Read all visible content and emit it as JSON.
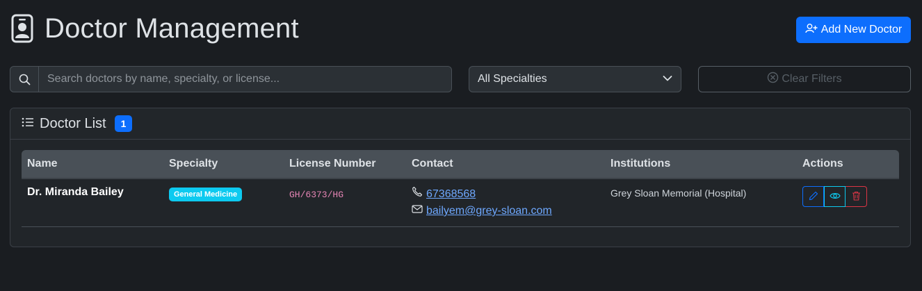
{
  "header": {
    "title": "Doctor Management",
    "add_button_label": "Add New Doctor"
  },
  "filters": {
    "search_placeholder": "Search doctors by name, specialty, or license...",
    "specialty_selected": "All Specialties",
    "clear_label": "Clear Filters"
  },
  "list": {
    "title": "Doctor List",
    "count": "1",
    "columns": [
      "Name",
      "Specialty",
      "License Number",
      "Contact",
      "Institutions",
      "Actions"
    ],
    "rows": [
      {
        "name": "Dr. Miranda Bailey",
        "specialty": "General Medicine",
        "license": "GH/6373/HG",
        "phone": "67368568",
        "email": "bailyem@grey-sloan.com",
        "institution": "Grey Sloan Memorial (Hospital)"
      }
    ]
  },
  "colors": {
    "background": "#1a1d21",
    "primary": "#0d6efd",
    "info": "#0dcaf0",
    "danger": "#dc3545",
    "license_text": "#e685b5"
  },
  "icons": {
    "title": "person-badge-icon",
    "add": "person-plus-icon",
    "search": "search-icon",
    "select": "chevron-down-icon",
    "clear": "x-circle-icon",
    "list": "list-icon",
    "phone": "telephone-icon",
    "email": "envelope-icon",
    "edit": "pencil-icon",
    "view": "eye-icon",
    "delete": "trash-icon"
  }
}
